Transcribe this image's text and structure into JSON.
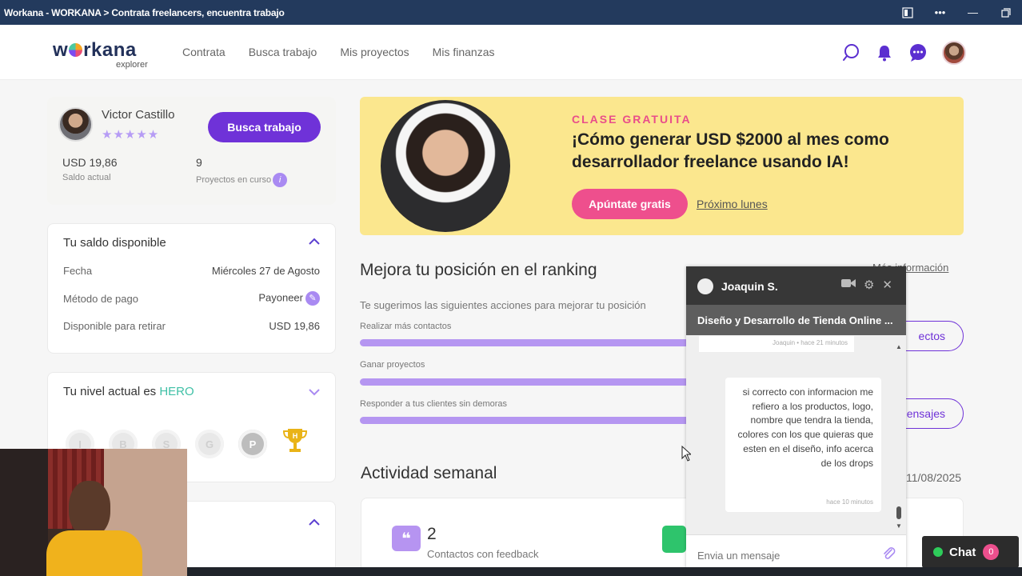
{
  "window": {
    "title": "Workana - WORKANA > Contrata freelancers, encuentra trabajo"
  },
  "nav": {
    "logo_text": "workana",
    "logo_sub": "explorer",
    "menu": [
      "Contrata",
      "Busca trabajo",
      "Mis proyectos",
      "Mis finanzas"
    ],
    "icons": [
      "search-icon",
      "bell-icon",
      "chat-bubble-icon",
      "avatar"
    ]
  },
  "profile": {
    "name": "Victor Castillo",
    "stars": "★★★★★",
    "button": "Busca trabajo",
    "balance_value": "USD 19,86",
    "balance_label": "Saldo actual",
    "projects_value": "9",
    "projects_label": "Proyectos en curso"
  },
  "saldo": {
    "title": "Tu saldo disponible",
    "rows": [
      {
        "label": "Fecha",
        "value": "Miércoles 27 de Agosto"
      },
      {
        "label": "Método de pago",
        "value": "Payoneer"
      },
      {
        "label": "Disponible para retirar",
        "value": "USD 19,86"
      }
    ]
  },
  "nivel": {
    "title_prefix": "Tu nivel actual es",
    "level": "HERO",
    "badges": [
      "I",
      "B",
      "S",
      "G",
      "P"
    ]
  },
  "banner": {
    "kicker": "CLASE GRATUITA",
    "title": "¡Cómo generar USD $2000 al mes como desarrollador freelance usando IA!",
    "button": "Apúntate gratis",
    "link": "Próximo lunes"
  },
  "ranking": {
    "title": "Mejora tu posición en el ranking",
    "more_link": "Más información",
    "subtitle": "Te sugerimos las siguientes acciones para mejorar tu posición",
    "items": [
      {
        "label": "Realizar más contactos",
        "progress": 1.0,
        "button": "ectos"
      },
      {
        "label": "Ganar proyectos",
        "progress": 1.0,
        "button": ""
      },
      {
        "label": "Responder a tus clientes sin demoras",
        "progress": 1.0,
        "button": "ensajes"
      }
    ]
  },
  "activity": {
    "title": "Actividad semanal",
    "date": "11/08/2025",
    "count": "2",
    "count_label": "Contactos con feedback"
  },
  "chat_panel": {
    "contact": "Joaquin S.",
    "topic": "Diseño y Desarrollo de Tienda Online ...",
    "prev_meta": "Joaquin • hace 21 minutos",
    "message": "si correcto con informacion me refiero a los productos, logo, nombre que tendra la tienda, colores con los que quieras que esten en el diseño, info acerca de los drops",
    "message_time": "hace 10 minutos",
    "input_placeholder": "Envia un mensaje"
  },
  "chat_button": {
    "label": "Chat",
    "count": "0"
  },
  "colors": {
    "primary": "#6f32d8",
    "pink": "#ee4f8d",
    "banner_bg": "#fbe78e",
    "titlebar": "#233a5d",
    "hero": "#3fc0a6"
  }
}
